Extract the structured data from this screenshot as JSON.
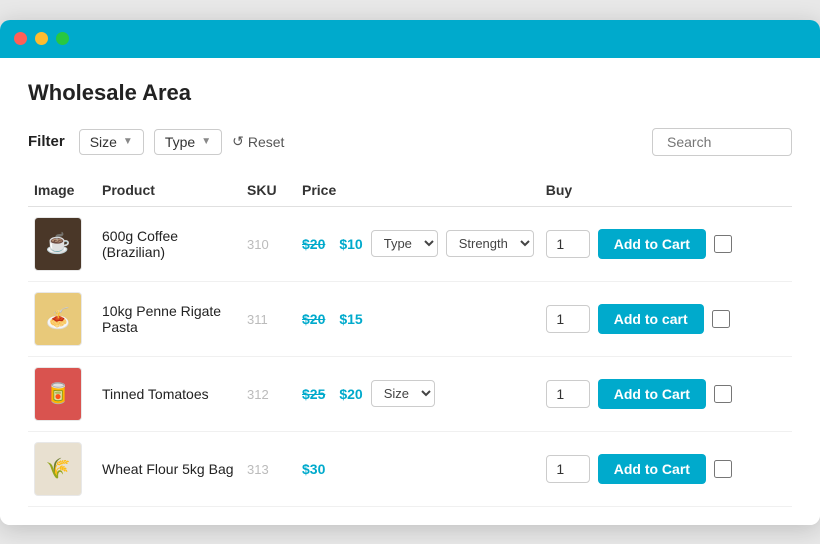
{
  "window": {
    "title": "Wholesale Area"
  },
  "titlebar": {
    "dots": [
      "red",
      "yellow",
      "green"
    ]
  },
  "page": {
    "title": "Wholesale Area"
  },
  "filter": {
    "label": "Filter",
    "size_label": "Size",
    "type_label": "Type",
    "reset_label": "Reset",
    "search_placeholder": "Search"
  },
  "table": {
    "headers": [
      "Image",
      "Product",
      "SKU",
      "Price",
      "Buy"
    ],
    "rows": [
      {
        "id": 1,
        "image_emoji": "☕",
        "image_bg": "#4a3728",
        "product": "600g Coffee (Brazilian)",
        "sku": "310",
        "price_original": "$20",
        "price_sale": "$10",
        "has_type": true,
        "has_strength": true,
        "type_label": "Type",
        "strength_label": "Strength",
        "qty": "1",
        "add_to_cart": "Add to Cart"
      },
      {
        "id": 2,
        "image_emoji": "🍝",
        "image_bg": "#e8c97a",
        "product": "10kg Penne Rigate Pasta",
        "sku": "311",
        "price_original": "$20",
        "price_sale": "$15",
        "has_type": false,
        "has_strength": false,
        "qty": "1",
        "add_to_cart": "Add to cart"
      },
      {
        "id": 3,
        "image_emoji": "🥫",
        "image_bg": "#d9534f",
        "product": "Tinned Tomatoes",
        "sku": "312",
        "price_original": "$25",
        "price_sale": "$20",
        "has_size": true,
        "size_label": "Size",
        "qty": "1",
        "add_to_cart": "Add to Cart"
      },
      {
        "id": 4,
        "image_emoji": "🌾",
        "image_bg": "#e8e0d0",
        "product": "Wheat Flour 5kg Bag",
        "sku": "313",
        "price_only": "$30",
        "has_type": false,
        "has_strength": false,
        "qty": "1",
        "add_to_cart": "Add to Cart"
      }
    ]
  }
}
